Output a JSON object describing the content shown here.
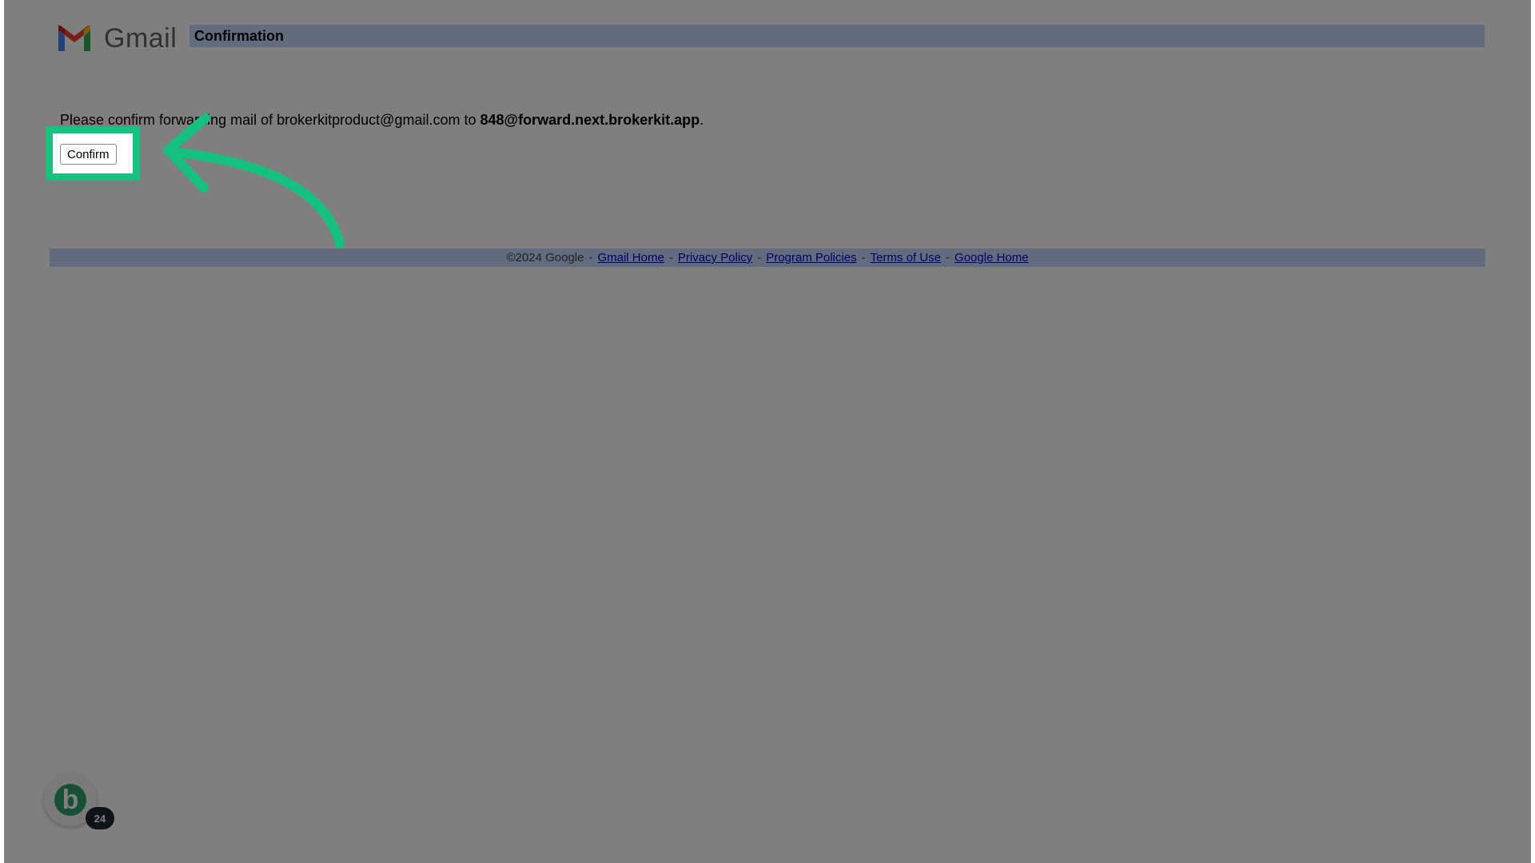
{
  "header": {
    "logo_text": "Gmail",
    "title": "Confirmation"
  },
  "message": {
    "prefix": "Please confirm forwarding mail of brokerkitproduct@gmail.com to ",
    "address": "848@forward.next.brokerkit.app",
    "suffix": "."
  },
  "confirm_label": "Confirm",
  "footer": {
    "copyright": "©2024 Google",
    "separator": "-",
    "links": [
      "Gmail Home",
      "Privacy Policy",
      "Program Policies",
      "Terms of Use",
      "Google Home"
    ]
  },
  "widget": {
    "letter": "b",
    "badge_count": "24"
  },
  "colors": {
    "accent": "#16c07f",
    "bar": "#c3d9ff",
    "link": "#0000cc",
    "widget_green": "#2ea36b"
  },
  "icons": {
    "logo": "gmail-logo-icon",
    "arrow": "curved-arrow-icon"
  }
}
